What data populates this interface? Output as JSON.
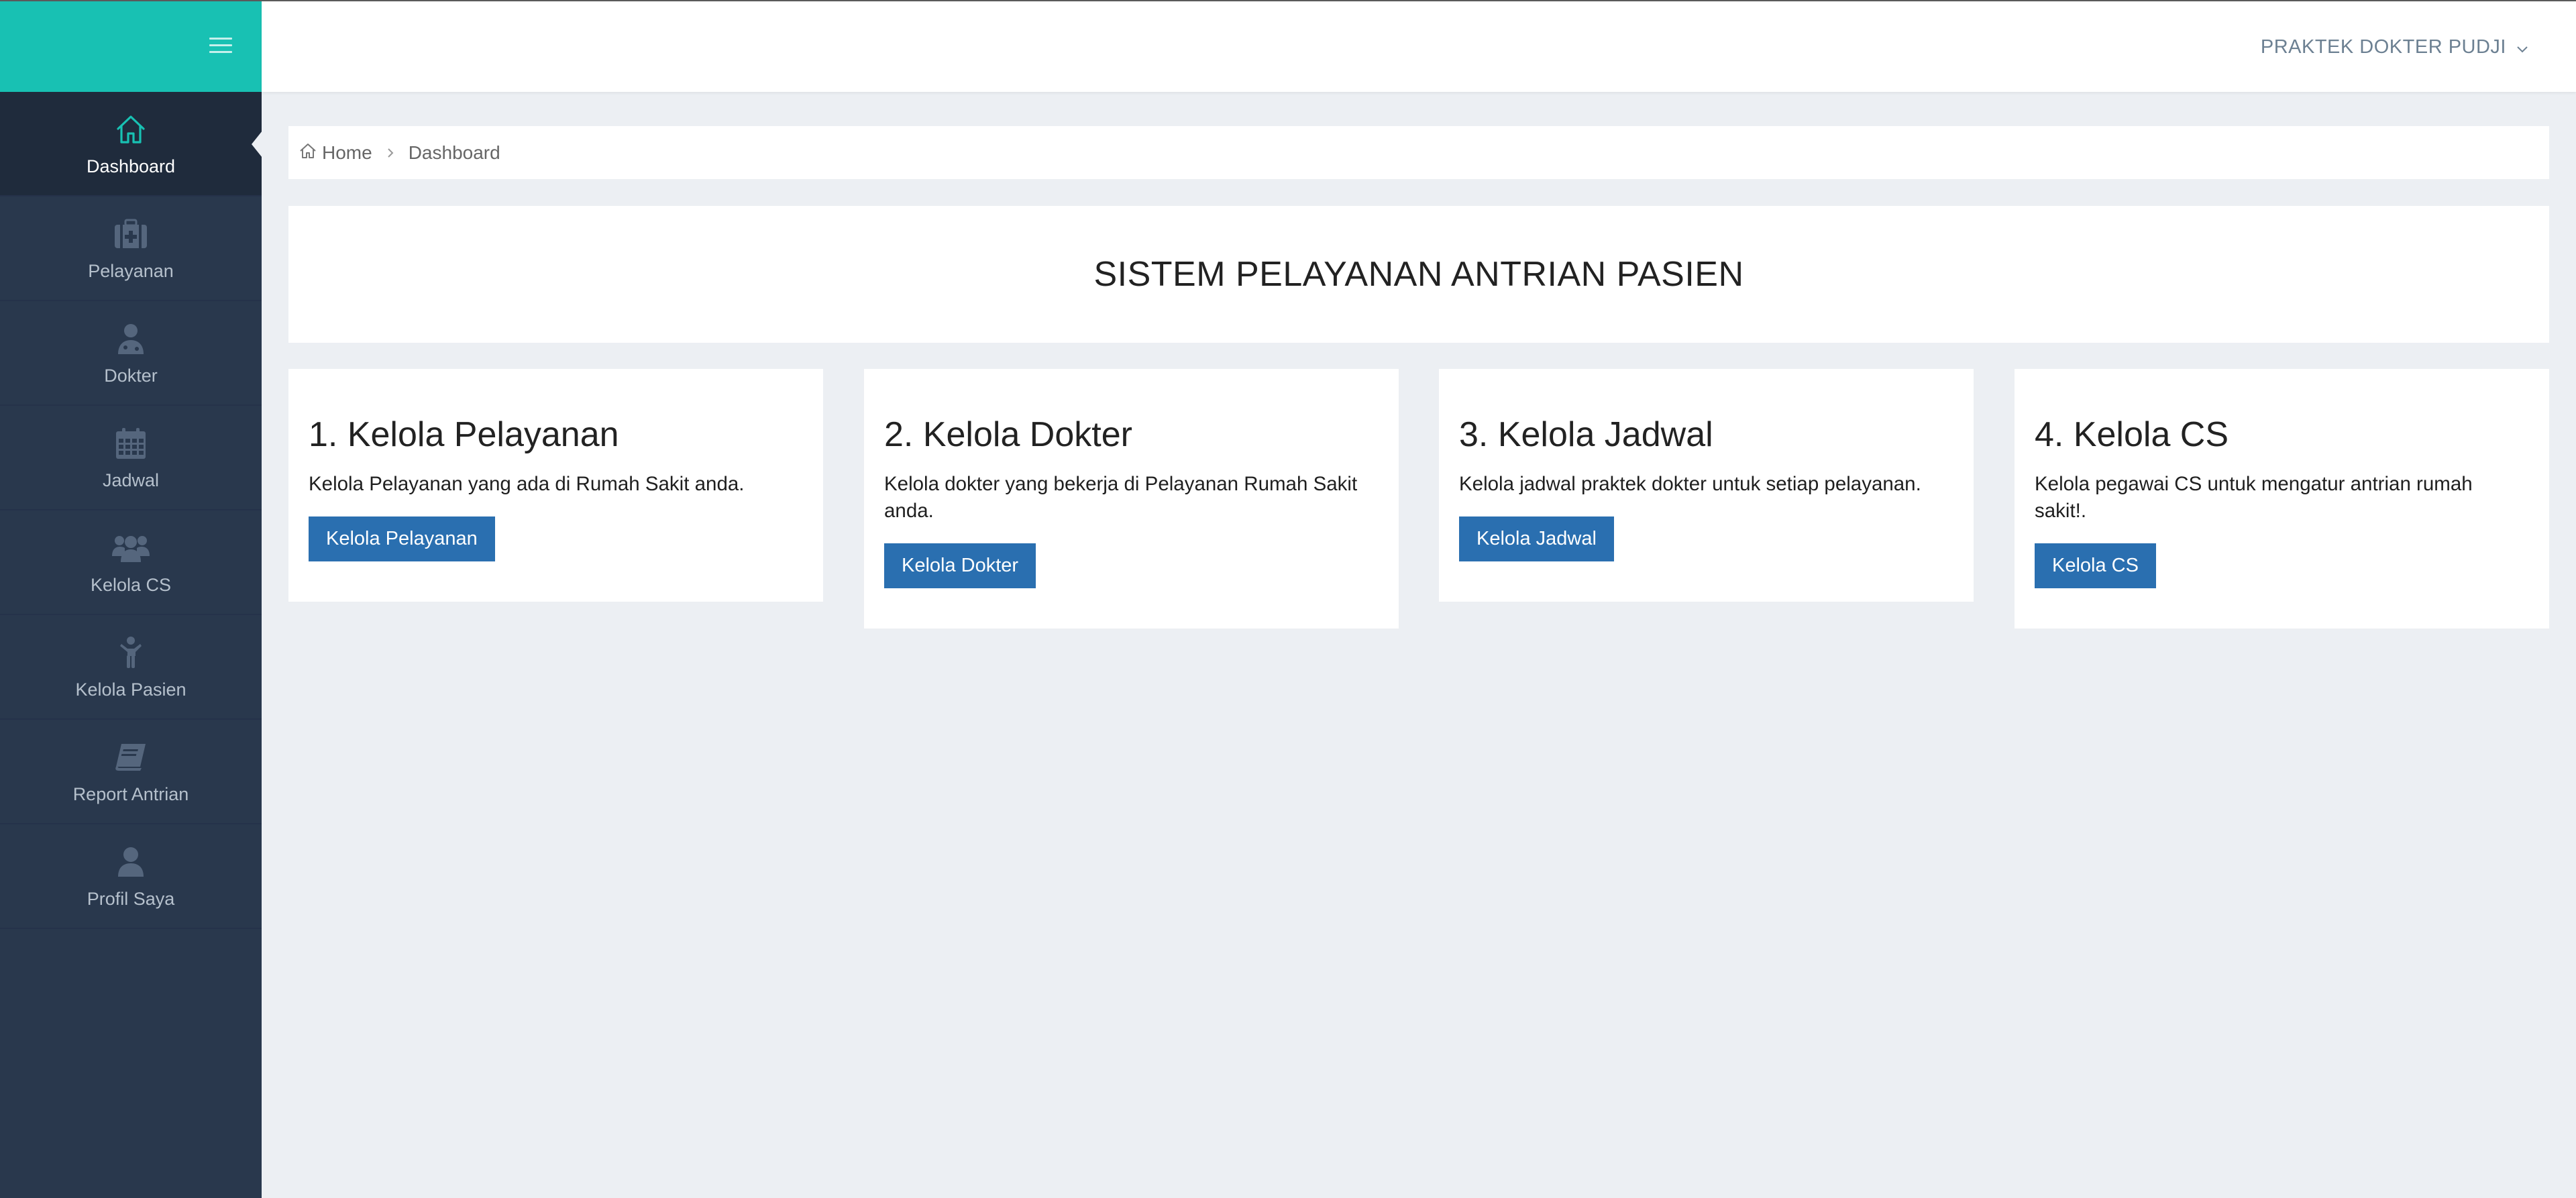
{
  "app": {
    "brand_color": "#18c1b3",
    "sidebar_color": "#29384d",
    "button_color": "#2a6fb0"
  },
  "topbar": {
    "user_label": "PRAKTEK DOKTER PUDJI"
  },
  "sidebar": {
    "items": [
      {
        "label": "Dashboard",
        "icon": "home-icon",
        "active": true
      },
      {
        "label": "Pelayanan",
        "icon": "medkit-icon"
      },
      {
        "label": "Dokter",
        "icon": "doctor-icon"
      },
      {
        "label": "Jadwal",
        "icon": "calendar-icon"
      },
      {
        "label": "Kelola CS",
        "icon": "users-icon"
      },
      {
        "label": "Kelola Pasien",
        "icon": "child-icon"
      },
      {
        "label": "Report Antrian",
        "icon": "book-icon"
      },
      {
        "label": "Profil Saya",
        "icon": "user-icon"
      }
    ]
  },
  "breadcrumb": {
    "home": "Home",
    "current": "Dashboard"
  },
  "main": {
    "title": "SISTEM PELAYANAN ANTRIAN PASIEN",
    "cards": [
      {
        "title": "1. Kelola Pelayanan",
        "text": "Kelola Pelayanan yang ada di Rumah Sakit anda.",
        "button": "Kelola Pelayanan"
      },
      {
        "title": "2. Kelola Dokter",
        "text": "Kelola dokter yang bekerja di Pelayanan Rumah Sakit anda.",
        "button": "Kelola Dokter"
      },
      {
        "title": "3. Kelola Jadwal",
        "text": "Kelola jadwal praktek dokter untuk setiap pelayanan.",
        "button": "Kelola Jadwal"
      },
      {
        "title": "4. Kelola CS",
        "text": "Kelola pegawai CS untuk mengatur antrian rumah sakit!.",
        "button": "Kelola CS"
      }
    ]
  }
}
